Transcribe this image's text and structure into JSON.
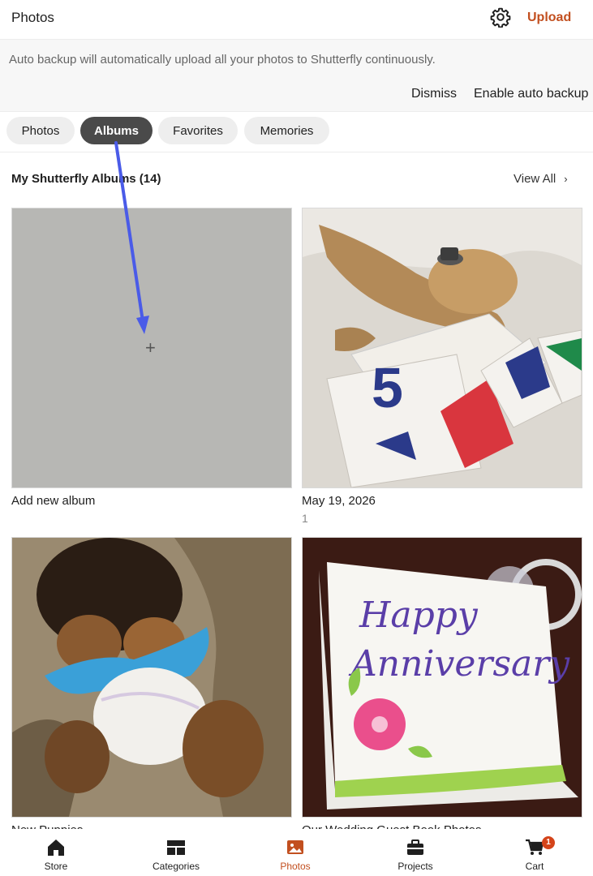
{
  "header": {
    "title": "Photos",
    "upload_label": "Upload",
    "settings_icon": "gear-icon"
  },
  "banner": {
    "message": "Auto backup will automatically upload all your photos to Shutterfly continuously.",
    "dismiss_label": "Dismiss",
    "enable_label": "Enable auto backup"
  },
  "tabs": [
    {
      "label": "Photos",
      "active": false
    },
    {
      "label": "Albums",
      "active": true
    },
    {
      "label": "Favorites",
      "active": false
    },
    {
      "label": "Memories",
      "active": false
    }
  ],
  "section": {
    "title": "My Shutterfly Albums (14)",
    "view_all_label": "View All",
    "view_all_icon": "chevron-right-icon"
  },
  "albums": [
    {
      "name": "Add new album",
      "count": "",
      "icon": "plus-icon"
    },
    {
      "name": "May 19, 2026",
      "count": "1"
    },
    {
      "name": "New Puppies",
      "count": ""
    },
    {
      "name": "Our Wedding Guest Book Photos",
      "count": ""
    }
  ],
  "bottom_nav": [
    {
      "label": "Store",
      "icon": "home-icon",
      "active": false
    },
    {
      "label": "Categories",
      "icon": "categories-icon",
      "active": false
    },
    {
      "label": "Photos",
      "icon": "photos-icon",
      "active": true
    },
    {
      "label": "Projects",
      "icon": "projects-icon",
      "active": false
    },
    {
      "label": "Cart",
      "icon": "cart-icon",
      "active": false,
      "badge": "1"
    }
  ],
  "colors": {
    "accent": "#c24f1f",
    "active_tab_bg": "#4a4a4a",
    "annotation_arrow": "#4a5be8"
  }
}
